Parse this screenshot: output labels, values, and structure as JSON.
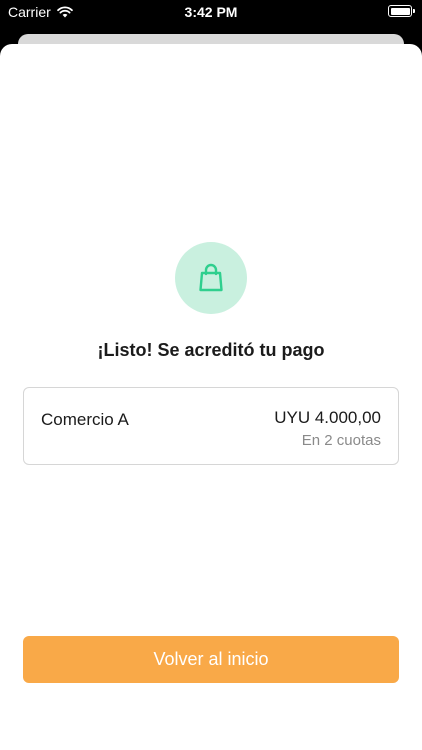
{
  "status_bar": {
    "carrier": "Carrier",
    "time": "3:42 PM"
  },
  "confirmation": {
    "icon": "shopping-bag-icon",
    "title": "¡Listo! Se acreditó tu pago"
  },
  "payment": {
    "merchant": "Comercio A",
    "amount": "UYU 4.000,00",
    "installments": "En 2 cuotas"
  },
  "actions": {
    "back_home_label": "Volver al inicio"
  },
  "colors": {
    "accent": "#f9a948",
    "success_light": "#c9f0df",
    "success": "#2fcf8e"
  }
}
